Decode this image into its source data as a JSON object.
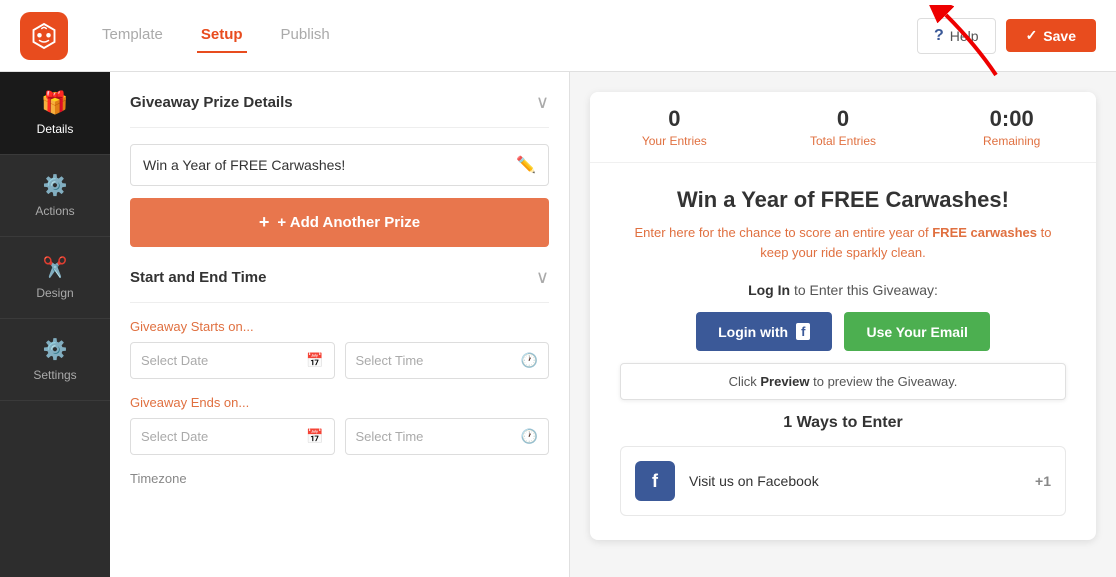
{
  "topnav": {
    "tabs": [
      {
        "id": "template",
        "label": "Template",
        "active": false
      },
      {
        "id": "setup",
        "label": "Setup",
        "active": true
      },
      {
        "id": "publish",
        "label": "Publish",
        "active": false
      }
    ],
    "help_label": "Help",
    "save_label": "Save"
  },
  "sidebar": {
    "items": [
      {
        "id": "details",
        "label": "Details",
        "icon": "🎁",
        "active": true
      },
      {
        "id": "actions",
        "label": "Actions",
        "icon": "⚙",
        "active": false
      },
      {
        "id": "design",
        "label": "Design",
        "icon": "✂",
        "active": false
      },
      {
        "id": "settings",
        "label": "Settings",
        "icon": "⚙",
        "active": false
      }
    ]
  },
  "left_panel": {
    "prize_section": {
      "title": "Giveaway Prize Details",
      "prize_name": "Win a Year of FREE Carwashes!",
      "add_prize_label": "+ Add Another Prize"
    },
    "schedule_section": {
      "title": "Start and End Time",
      "starts_label": "Giveaway Starts on...",
      "ends_label": "Giveaway Ends on...",
      "start_date_placeholder": "Select Date",
      "start_time_placeholder": "Select Time",
      "end_date_placeholder": "Select Date",
      "end_time_placeholder": "Select Time",
      "timezone_label": "Timezone"
    }
  },
  "preview": {
    "stats": [
      {
        "value": "0",
        "label": "Your Entries"
      },
      {
        "value": "0",
        "label": "Total Entries"
      },
      {
        "value": "0:00",
        "label": "Remaining"
      }
    ],
    "title": "Win a Year of FREE Carwashes!",
    "description_parts": [
      "Enter here for the chance to score an entire year of ",
      "FREE carwashes",
      " to keep your ride sparkly clean."
    ],
    "login_prompt_prefix": "Log In",
    "login_prompt_suffix": " to Enter this Giveaway:",
    "fb_login_label": "Login with",
    "email_login_label": "Use Your Email",
    "tooltip_prefix": "Click ",
    "tooltip_bold": "Preview",
    "tooltip_suffix": " to preview the Giveaway.",
    "ways_title": "1 Ways to Enter",
    "entry_label": "Visit us on Facebook",
    "entry_plus": "+1"
  }
}
